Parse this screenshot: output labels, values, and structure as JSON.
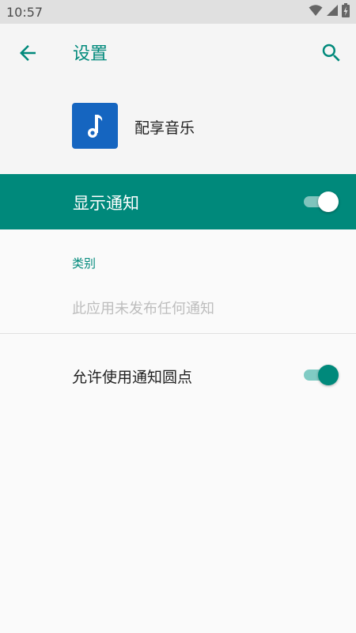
{
  "status_bar": {
    "time": "10:57",
    "icons": [
      "wifi-icon",
      "cell-signal-icon",
      "battery-icon"
    ]
  },
  "app_bar": {
    "title": "设置",
    "back_icon": "arrow-back-icon",
    "search_icon": "search-icon"
  },
  "app_info": {
    "name": "配享音乐",
    "icon": "music-note-icon",
    "icon_color": "#1565c0"
  },
  "show_notifications": {
    "label": "显示通知",
    "enabled": true
  },
  "categories": {
    "header": "类别",
    "empty_message": "此应用未发布任何通知"
  },
  "notification_dots": {
    "label": "允许使用通知圆点",
    "enabled": true
  },
  "colors": {
    "accent": "#00897b",
    "accent_light": "#80cbc4",
    "status_bar": "#e0e0e0",
    "background": "#fafafa"
  }
}
